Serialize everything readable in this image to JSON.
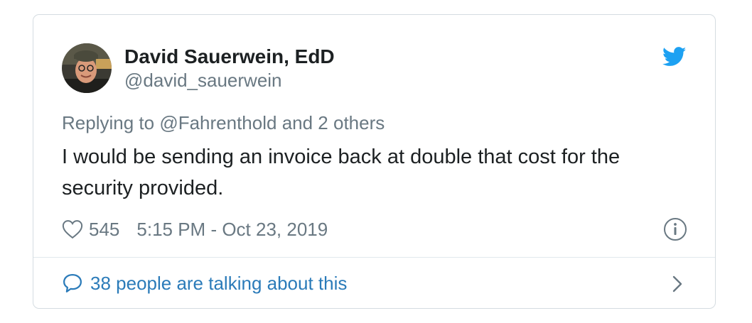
{
  "tweet": {
    "author": {
      "name": "David Sauerwein, EdD",
      "handle": "@david_sauerwein"
    },
    "reply_prefix": "Replying to ",
    "reply_to": "@Fahrenthold",
    "reply_suffix": " and 2 others",
    "text": "I would be sending an invoice back at double that cost for the security provided.",
    "likes": "545",
    "timestamp": "5:15 PM - Oct 23, 2019",
    "talking": "38 people are talking about this"
  },
  "colors": {
    "text": "#1c2022",
    "muted": "#697882",
    "link": "#2b7bb9",
    "twitter_blue": "#1da1f2",
    "border": "#d5dce1"
  },
  "icons": [
    "twitter-bird-icon",
    "heart-icon",
    "info-icon",
    "speech-bubble-icon",
    "chevron-right-icon"
  ]
}
